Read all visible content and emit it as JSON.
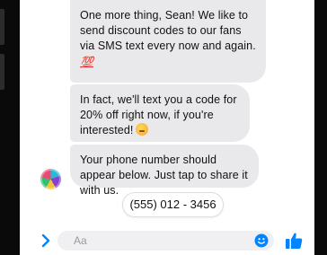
{
  "messages": [
    {
      "text": "One more thing, Sean! We like to send discount codes to our fans via SMS text every now and again.",
      "emoji": "💯"
    },
    {
      "text": "In fact, we'll text you a code for 20% off right now, if you're interested!",
      "emoji": "😅"
    },
    {
      "text": "Your phone number should appear below. Just tap to share it with us."
    }
  ],
  "quick_reply": {
    "label": "(555) 012 - 3456"
  },
  "composer": {
    "placeholder": "Aa",
    "expand_icon": "chevron-right-icon",
    "emoji_icon": "smiley-icon",
    "like_icon": "thumbs-up-icon"
  },
  "colors": {
    "bubble": "#e9e9eb",
    "accent": "#0084ff",
    "bezel": "#0a0a0a"
  }
}
